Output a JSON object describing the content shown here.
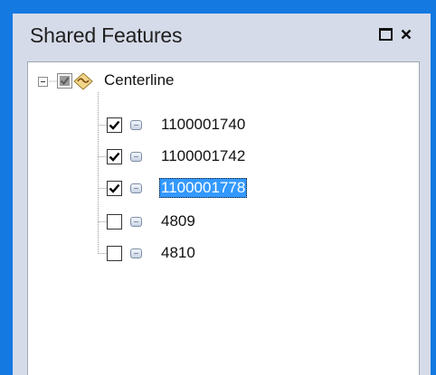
{
  "panel": {
    "title": "Shared Features",
    "accent_color": "#3399ff",
    "background_color": "#1479e0",
    "titlebar_buttons": [
      {
        "name": "maximize",
        "icon": "maximize-icon"
      },
      {
        "name": "close",
        "icon": "close-icon"
      }
    ]
  },
  "tree": {
    "root": {
      "label": "Centerline",
      "expanded": true,
      "check_state": "indeterminate",
      "icon": "line-layer-icon"
    },
    "items": [
      {
        "label": "1100001740",
        "checked": true,
        "selected": false,
        "icon": "feature-icon"
      },
      {
        "label": "1100001742",
        "checked": true,
        "selected": false,
        "icon": "feature-icon"
      },
      {
        "label": "1100001778",
        "checked": true,
        "selected": true,
        "icon": "feature-icon"
      },
      {
        "label": "4809",
        "checked": false,
        "selected": false,
        "icon": "feature-icon"
      },
      {
        "label": "4810",
        "checked": false,
        "selected": false,
        "icon": "feature-icon"
      }
    ]
  }
}
